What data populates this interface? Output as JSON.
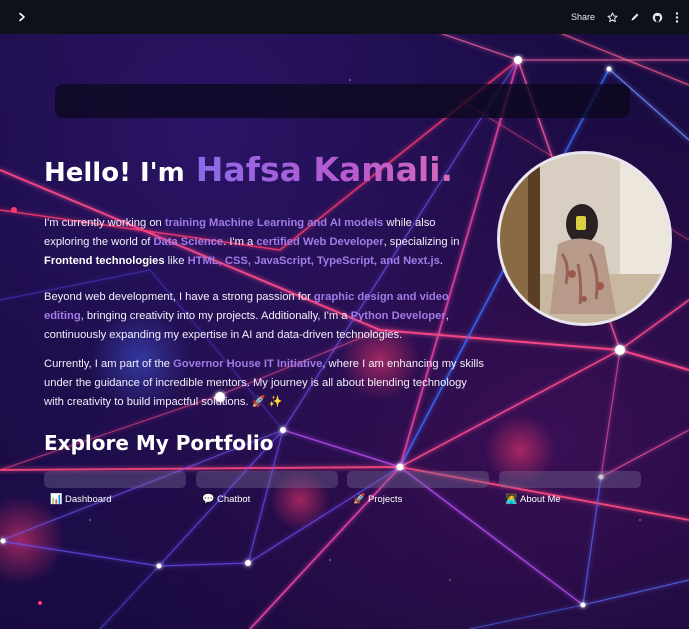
{
  "topbar": {
    "share_label": "Share",
    "icons": [
      "chevron-right-icon",
      "star-icon",
      "pencil-icon",
      "github-icon",
      "more-vertical-icon"
    ]
  },
  "hero": {
    "greeting": "Hello! I'm",
    "name": "Hafsa Kamali."
  },
  "about": {
    "p1": {
      "t1": "I'm currently working on ",
      "h1": "training Machine Learning and AI models",
      "t2": " while also exploring the world of ",
      "h2": "Data Science",
      "t3": ". I'm a ",
      "h3": "certified Web Developer",
      "t4": ", specializing in ",
      "b1": "Frontend technologies",
      "t5": " like ",
      "h4": "HTML, CSS, JavaScript, TypeScript, and Next.js",
      "t6": "."
    },
    "p2": {
      "t1": "Beyond web development, I have a strong passion for ",
      "h1": "graphic design and video editing",
      "t2": ", bringing creativity into my projects. Additionally, I'm a ",
      "h2": "Python Developer",
      "t3": ", continuously expanding my expertise in AI and data-driven technologies."
    },
    "p3": {
      "t1": "Currently, I am part of the ",
      "h1": "Governor House IT Initiative",
      "t2": ", where I am enhancing my skills under the guidance of incredible mentors. My journey is all about blending technology with creativity to build impactful solutions. ",
      "emoji": "🚀 ✨"
    }
  },
  "portfolio": {
    "heading": "Explore My Portfolio",
    "links": [
      {
        "icon": "📊",
        "icon_name": "bar-chart-icon",
        "label": "Dashboard"
      },
      {
        "icon": "💬",
        "icon_name": "speech-bubble-icon",
        "label": "Chatbot"
      },
      {
        "icon": "🚀",
        "icon_name": "rocket-icon",
        "label": "Projects"
      },
      {
        "icon": "👩‍💻",
        "icon_name": "technologist-icon",
        "label": "About Me"
      }
    ]
  },
  "colors": {
    "topbar": "#0e1117",
    "highlight": "#a07be6",
    "name_gradient_start": "#8a6be8",
    "name_gradient_end": "#d66ab8"
  }
}
